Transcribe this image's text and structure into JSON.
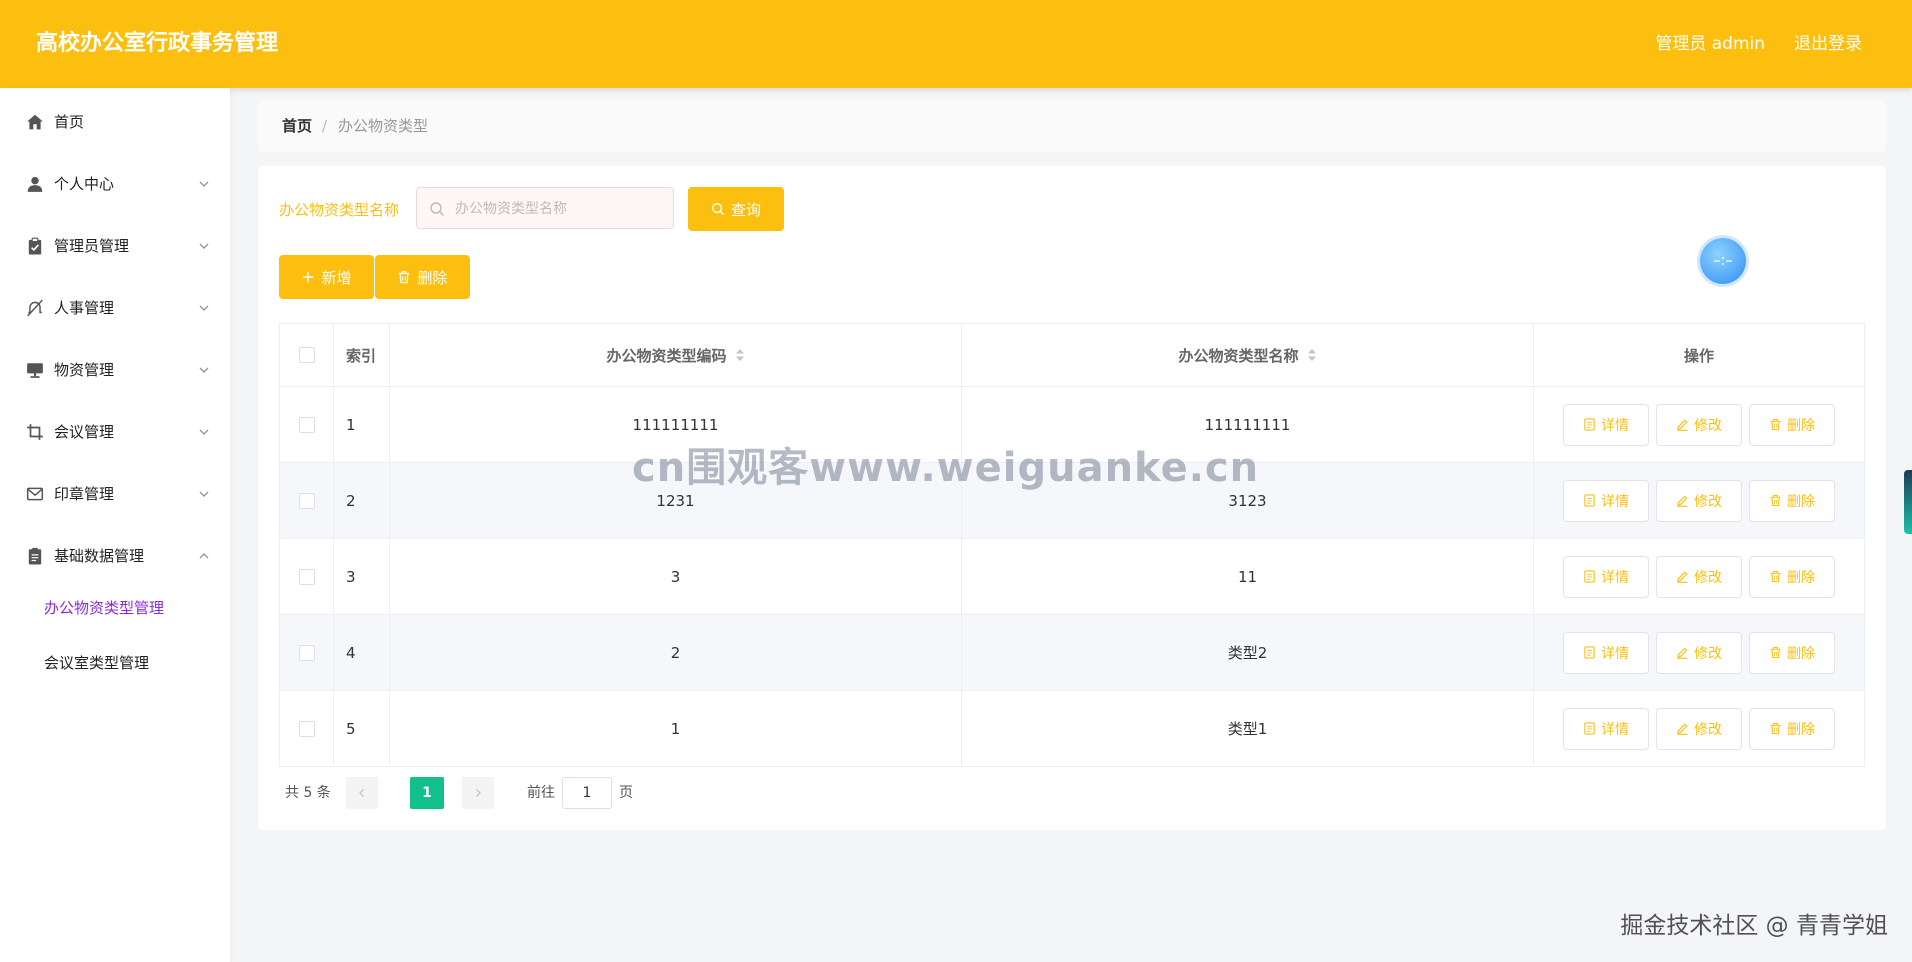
{
  "header": {
    "title": "高校办公室行政事务管理",
    "admin_label": "管理员 admin",
    "logout_label": "退出登录"
  },
  "sidebar": {
    "items": [
      {
        "label": "首页",
        "icon": "home-icon"
      },
      {
        "label": "个人中心",
        "icon": "user-icon"
      },
      {
        "label": "管理员管理",
        "icon": "clipboard-icon"
      },
      {
        "label": "人事管理",
        "icon": "bell-off-icon"
      },
      {
        "label": "物资管理",
        "icon": "monitor-icon"
      },
      {
        "label": "会议管理",
        "icon": "crop-icon"
      },
      {
        "label": "印章管理",
        "icon": "mail-icon"
      },
      {
        "label": "基础数据管理",
        "icon": "document-icon"
      }
    ],
    "sub_items": [
      {
        "label": "办公物资类型管理",
        "active": true
      },
      {
        "label": "会议室类型管理",
        "active": false
      }
    ]
  },
  "breadcrumb": {
    "home": "首页",
    "separator": "/",
    "current": "办公物资类型"
  },
  "filter": {
    "label": "办公物资类型名称",
    "placeholder": "办公物资类型名称",
    "query_label": "查询"
  },
  "actions": {
    "add_label": "新增",
    "delete_label": "删除"
  },
  "table": {
    "columns": [
      "索引",
      "办公物资类型编码",
      "办公物资类型名称",
      "操作"
    ],
    "rows": [
      {
        "index": "1",
        "code": "111111111",
        "name": "111111111"
      },
      {
        "index": "2",
        "code": "1231",
        "name": "3123"
      },
      {
        "index": "3",
        "code": "3",
        "name": "11"
      },
      {
        "index": "4",
        "code": "2",
        "name": "类型2"
      },
      {
        "index": "5",
        "code": "1",
        "name": "类型1"
      }
    ],
    "op_labels": {
      "detail": "详情",
      "edit": "修改",
      "delete": "删除"
    }
  },
  "pagination": {
    "total_text": "共 5 条",
    "current_page": "1",
    "goto_label": "前往",
    "goto_value": "1",
    "page_suffix": "页"
  },
  "watermarks": {
    "center": "cn围观客www.weiguanke.cn",
    "bottom_right": "掘金技术社区 @ 青青学姐"
  },
  "colors": {
    "primary": "#fdbf0f",
    "active_page": "#13c08c",
    "active_submenu": "#8a2be2"
  }
}
